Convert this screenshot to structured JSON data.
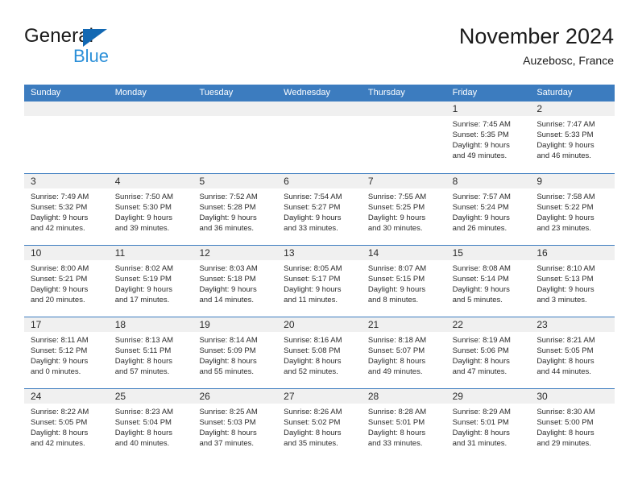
{
  "brand": {
    "name_part1": "General",
    "name_part2": "Blue",
    "triangle_color": "#1268b3",
    "blue_text_color": "#2b8fd8"
  },
  "header": {
    "title": "November 2024",
    "subtitle": "Auzebosc, France"
  },
  "theme": {
    "header_blue": "#3c7cbf",
    "day_band_gray": "#f0f0f0",
    "text_color": "#2b2b2b"
  },
  "weekdays": [
    "Sunday",
    "Monday",
    "Tuesday",
    "Wednesday",
    "Thursday",
    "Friday",
    "Saturday"
  ],
  "weeks": [
    [
      {
        "day": "",
        "empty": true
      },
      {
        "day": "",
        "empty": true
      },
      {
        "day": "",
        "empty": true
      },
      {
        "day": "",
        "empty": true
      },
      {
        "day": "",
        "empty": true
      },
      {
        "day": "1",
        "sunrise": "Sunrise: 7:45 AM",
        "sunset": "Sunset: 5:35 PM",
        "daylight1": "Daylight: 9 hours",
        "daylight2": "and 49 minutes."
      },
      {
        "day": "2",
        "sunrise": "Sunrise: 7:47 AM",
        "sunset": "Sunset: 5:33 PM",
        "daylight1": "Daylight: 9 hours",
        "daylight2": "and 46 minutes."
      }
    ],
    [
      {
        "day": "3",
        "sunrise": "Sunrise: 7:49 AM",
        "sunset": "Sunset: 5:32 PM",
        "daylight1": "Daylight: 9 hours",
        "daylight2": "and 42 minutes."
      },
      {
        "day": "4",
        "sunrise": "Sunrise: 7:50 AM",
        "sunset": "Sunset: 5:30 PM",
        "daylight1": "Daylight: 9 hours",
        "daylight2": "and 39 minutes."
      },
      {
        "day": "5",
        "sunrise": "Sunrise: 7:52 AM",
        "sunset": "Sunset: 5:28 PM",
        "daylight1": "Daylight: 9 hours",
        "daylight2": "and 36 minutes."
      },
      {
        "day": "6",
        "sunrise": "Sunrise: 7:54 AM",
        "sunset": "Sunset: 5:27 PM",
        "daylight1": "Daylight: 9 hours",
        "daylight2": "and 33 minutes."
      },
      {
        "day": "7",
        "sunrise": "Sunrise: 7:55 AM",
        "sunset": "Sunset: 5:25 PM",
        "daylight1": "Daylight: 9 hours",
        "daylight2": "and 30 minutes."
      },
      {
        "day": "8",
        "sunrise": "Sunrise: 7:57 AM",
        "sunset": "Sunset: 5:24 PM",
        "daylight1": "Daylight: 9 hours",
        "daylight2": "and 26 minutes."
      },
      {
        "day": "9",
        "sunrise": "Sunrise: 7:58 AM",
        "sunset": "Sunset: 5:22 PM",
        "daylight1": "Daylight: 9 hours",
        "daylight2": "and 23 minutes."
      }
    ],
    [
      {
        "day": "10",
        "sunrise": "Sunrise: 8:00 AM",
        "sunset": "Sunset: 5:21 PM",
        "daylight1": "Daylight: 9 hours",
        "daylight2": "and 20 minutes."
      },
      {
        "day": "11",
        "sunrise": "Sunrise: 8:02 AM",
        "sunset": "Sunset: 5:19 PM",
        "daylight1": "Daylight: 9 hours",
        "daylight2": "and 17 minutes."
      },
      {
        "day": "12",
        "sunrise": "Sunrise: 8:03 AM",
        "sunset": "Sunset: 5:18 PM",
        "daylight1": "Daylight: 9 hours",
        "daylight2": "and 14 minutes."
      },
      {
        "day": "13",
        "sunrise": "Sunrise: 8:05 AM",
        "sunset": "Sunset: 5:17 PM",
        "daylight1": "Daylight: 9 hours",
        "daylight2": "and 11 minutes."
      },
      {
        "day": "14",
        "sunrise": "Sunrise: 8:07 AM",
        "sunset": "Sunset: 5:15 PM",
        "daylight1": "Daylight: 9 hours",
        "daylight2": "and 8 minutes."
      },
      {
        "day": "15",
        "sunrise": "Sunrise: 8:08 AM",
        "sunset": "Sunset: 5:14 PM",
        "daylight1": "Daylight: 9 hours",
        "daylight2": "and 5 minutes."
      },
      {
        "day": "16",
        "sunrise": "Sunrise: 8:10 AM",
        "sunset": "Sunset: 5:13 PM",
        "daylight1": "Daylight: 9 hours",
        "daylight2": "and 3 minutes."
      }
    ],
    [
      {
        "day": "17",
        "sunrise": "Sunrise: 8:11 AM",
        "sunset": "Sunset: 5:12 PM",
        "daylight1": "Daylight: 9 hours",
        "daylight2": "and 0 minutes."
      },
      {
        "day": "18",
        "sunrise": "Sunrise: 8:13 AM",
        "sunset": "Sunset: 5:11 PM",
        "daylight1": "Daylight: 8 hours",
        "daylight2": "and 57 minutes."
      },
      {
        "day": "19",
        "sunrise": "Sunrise: 8:14 AM",
        "sunset": "Sunset: 5:09 PM",
        "daylight1": "Daylight: 8 hours",
        "daylight2": "and 55 minutes."
      },
      {
        "day": "20",
        "sunrise": "Sunrise: 8:16 AM",
        "sunset": "Sunset: 5:08 PM",
        "daylight1": "Daylight: 8 hours",
        "daylight2": "and 52 minutes."
      },
      {
        "day": "21",
        "sunrise": "Sunrise: 8:18 AM",
        "sunset": "Sunset: 5:07 PM",
        "daylight1": "Daylight: 8 hours",
        "daylight2": "and 49 minutes."
      },
      {
        "day": "22",
        "sunrise": "Sunrise: 8:19 AM",
        "sunset": "Sunset: 5:06 PM",
        "daylight1": "Daylight: 8 hours",
        "daylight2": "and 47 minutes."
      },
      {
        "day": "23",
        "sunrise": "Sunrise: 8:21 AM",
        "sunset": "Sunset: 5:05 PM",
        "daylight1": "Daylight: 8 hours",
        "daylight2": "and 44 minutes."
      }
    ],
    [
      {
        "day": "24",
        "sunrise": "Sunrise: 8:22 AM",
        "sunset": "Sunset: 5:05 PM",
        "daylight1": "Daylight: 8 hours",
        "daylight2": "and 42 minutes."
      },
      {
        "day": "25",
        "sunrise": "Sunrise: 8:23 AM",
        "sunset": "Sunset: 5:04 PM",
        "daylight1": "Daylight: 8 hours",
        "daylight2": "and 40 minutes."
      },
      {
        "day": "26",
        "sunrise": "Sunrise: 8:25 AM",
        "sunset": "Sunset: 5:03 PM",
        "daylight1": "Daylight: 8 hours",
        "daylight2": "and 37 minutes."
      },
      {
        "day": "27",
        "sunrise": "Sunrise: 8:26 AM",
        "sunset": "Sunset: 5:02 PM",
        "daylight1": "Daylight: 8 hours",
        "daylight2": "and 35 minutes."
      },
      {
        "day": "28",
        "sunrise": "Sunrise: 8:28 AM",
        "sunset": "Sunset: 5:01 PM",
        "daylight1": "Daylight: 8 hours",
        "daylight2": "and 33 minutes."
      },
      {
        "day": "29",
        "sunrise": "Sunrise: 8:29 AM",
        "sunset": "Sunset: 5:01 PM",
        "daylight1": "Daylight: 8 hours",
        "daylight2": "and 31 minutes."
      },
      {
        "day": "30",
        "sunrise": "Sunrise: 8:30 AM",
        "sunset": "Sunset: 5:00 PM",
        "daylight1": "Daylight: 8 hours",
        "daylight2": "and 29 minutes."
      }
    ]
  ]
}
